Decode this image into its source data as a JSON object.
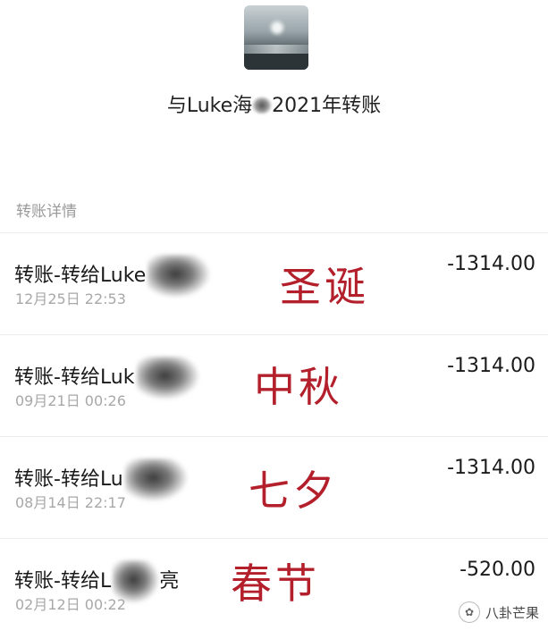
{
  "header": {
    "title_prefix": "与Luke",
    "title_partial": "海",
    "title_suffix": "2021年转账"
  },
  "section": {
    "label": "转账详情"
  },
  "transfers": [
    {
      "title": "转账-转给Luke",
      "date": "12月25日  22:53",
      "amount": "-1314.00",
      "annotation": "圣诞"
    },
    {
      "title": "转账-转给Luk",
      "date": "09月21日  00:26",
      "amount": "-1314.00",
      "annotation": "中秋"
    },
    {
      "title": "转账-转给Lu",
      "date": "08月14日  22:17",
      "amount": "-1314.00",
      "annotation": "七夕"
    },
    {
      "title": "转账-转给L",
      "date": "02月12日  00:22",
      "amount": "-520.00",
      "annotation": "春节",
      "title_tail": "亮"
    }
  ],
  "watermark": {
    "text": "八卦芒果",
    "icon": "wechat-channel-icon"
  },
  "colors": {
    "annotation_red": "#b3202b",
    "muted_text": "#a8a8a8"
  }
}
